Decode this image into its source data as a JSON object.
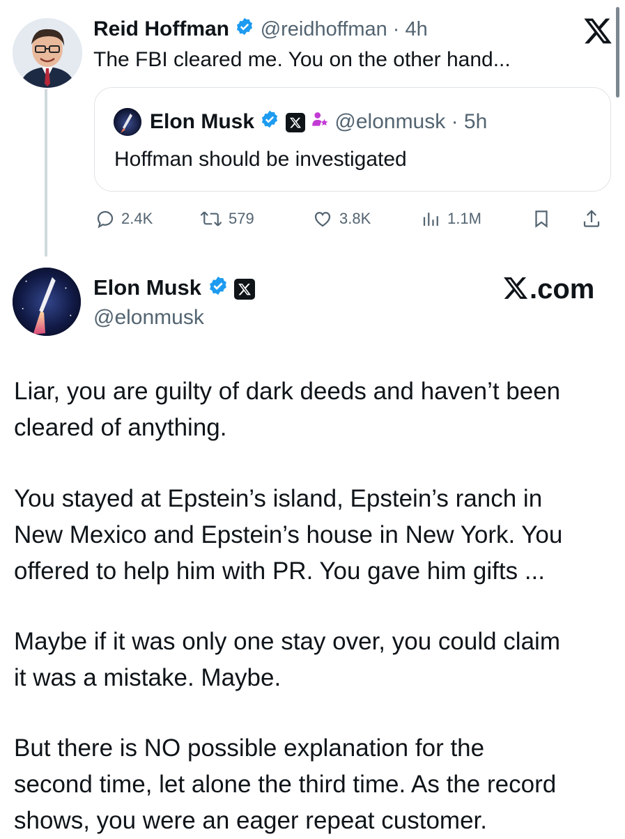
{
  "reply_tweet": {
    "author_name": "Reid Hoffman",
    "handle_time": "@reidhoffman · 4h",
    "text": "The FBI cleared me. You on the other hand..."
  },
  "quoted_tweet": {
    "author_name": "Elon Musk",
    "handle_time": "@elonmusk · 5h",
    "text": "Hoffman should be investigated"
  },
  "actions": {
    "replies": "2.4K",
    "reposts": "579",
    "likes": "3.8K",
    "views": "1.1M"
  },
  "main_post": {
    "author_name": "Elon Musk",
    "handle": "@elonmusk",
    "site_label": ".com",
    "paragraphs": [
      [
        "Liar, you are guilty of dark deeds and haven’t been",
        "cleared of anything."
      ],
      [
        "You stayed at Epstein’s island, Epstein’s ranch in",
        "New Mexico and Epstein’s house in New York. You",
        "offered to help him with PR. You gave him gifts ..."
      ],
      [
        "Maybe if it was only one stay over, you could claim",
        "it was a mistake. Maybe."
      ],
      [
        "But there is NO possible explanation for the",
        "second time, let alone the third time. As the record",
        "shows, you were an eager repeat customer."
      ]
    ]
  },
  "colors": {
    "verified_blue": "#1d9bf0",
    "muted_text": "#536471",
    "badge_pink": "#c23bd4"
  },
  "icons": [
    "x-logo-icon",
    "verified-badge-icon",
    "x-affiliate-badge-icon",
    "gov-badge-icon",
    "reply-icon",
    "repost-icon",
    "like-icon",
    "views-icon",
    "bookmark-icon",
    "share-icon"
  ]
}
